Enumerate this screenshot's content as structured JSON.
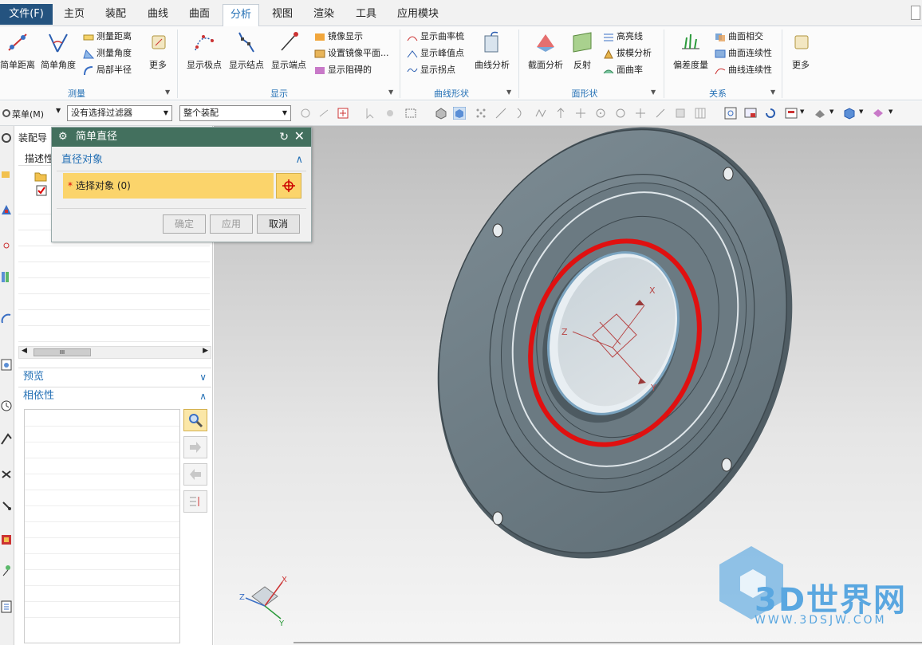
{
  "menubar": {
    "file": "文件(F)",
    "tabs": [
      "主页",
      "装配",
      "曲线",
      "曲面",
      "分析",
      "视图",
      "渲染",
      "工具",
      "应用模块"
    ],
    "active_tab": "分析"
  },
  "ribbon": {
    "measure": {
      "simple_distance": "简单距离",
      "simple_angle": "简单角度",
      "measure_distance": "测量距离",
      "measure_angle": "测量角度",
      "local_radius": "局部半径",
      "more": "更多",
      "label": "测量"
    },
    "display": {
      "show_poles": "显示极点",
      "show_knots": "显示结点",
      "show_endpoints": "显示端点",
      "mirror_display": "镜像显示",
      "set_mirror_plane": "设置镜像平面...",
      "show_damping": "显示阻碍的",
      "label": "显示"
    },
    "curve_shape": {
      "show_curvature_comb": "显示曲率梳",
      "show_peak": "显示峰值点",
      "show_inflection": "显示拐点",
      "curve_analysis": "曲线分析",
      "label": "曲线形状"
    },
    "face_shape": {
      "section_analysis": "截面分析",
      "reflection": "反射",
      "highlight_lines": "高亮线",
      "draft_analysis": "拔模分析",
      "face_curvature": "面曲率",
      "label": "面形状"
    },
    "relation": {
      "deviation_gauge": "偏差度量",
      "face_intersect": "曲面相交",
      "face_continuity": "曲面连续性",
      "curve_continuity": "曲线连续性",
      "label": "关系"
    },
    "more": "更多"
  },
  "toolbar2": {
    "menu": "菜单(M)",
    "filter": "没有选择过滤器",
    "scope": "整个装配"
  },
  "nav_panel": {
    "title": "装配导",
    "col_desc": "描述性",
    "preview": "预览",
    "dependencies": "相依性",
    "scroll_mark": "III"
  },
  "dialog": {
    "title": "简单直径",
    "group": "直径对象",
    "select_label": "选择对象 (0)",
    "ok": "确定",
    "apply": "应用",
    "cancel": "取消"
  },
  "viewport": {
    "axis_x": "X",
    "axis_y": "Y",
    "axis_z": "Z"
  },
  "watermark": {
    "brand": "3D世界网",
    "url": "WWW.3DSJW.COM"
  },
  "colors": {
    "highlight_circle": "#e01010",
    "dialog_title": "#43705e",
    "select_bg": "#fbd46b",
    "part": "#6c7c84"
  }
}
